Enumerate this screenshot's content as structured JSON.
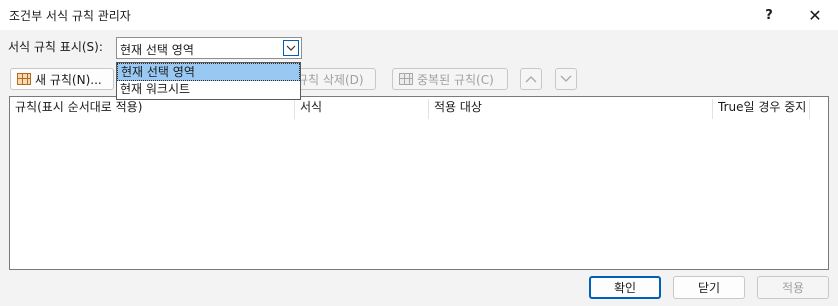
{
  "window": {
    "title": "조건부 서식 규칙 관리자",
    "help_label": "?",
    "close_label": "✕"
  },
  "show_rules": {
    "label": "서식 규칙 표시(S):",
    "selected": "현재 선택 영역",
    "options": [
      "현재 선택 영역",
      "현재 워크시트"
    ]
  },
  "toolbar": {
    "new_rule": "새 규칙(N)...",
    "edit_rule": "",
    "delete_rule": "규칙 삭제(D)",
    "duplicate_rule": "중복된 규칙(C)"
  },
  "table": {
    "columns": [
      "규칙(표시 순서대로 적용)",
      "서식",
      "적용 대상",
      "True일 경우 중지"
    ]
  },
  "footer": {
    "ok": "확인",
    "close": "닫기",
    "apply": "적용"
  }
}
